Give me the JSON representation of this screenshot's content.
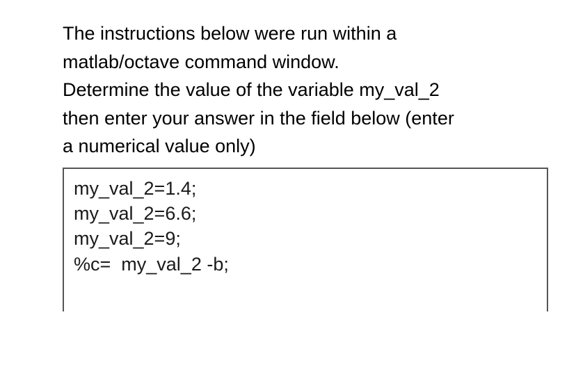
{
  "question": {
    "line1": "The instructions below were run within a",
    "line2": "matlab/octave command window.",
    "line3": "Determine the value of the variable my_val_2",
    "line4": "then enter your answer in the field below (enter",
    "line5": "a numerical value only)"
  },
  "code": {
    "line1": "my_val_2=1.4;",
    "line2": "my_val_2=6.6;",
    "line3": "my_val_2=9;",
    "line4": "%c=  my_val_2 -b;"
  }
}
